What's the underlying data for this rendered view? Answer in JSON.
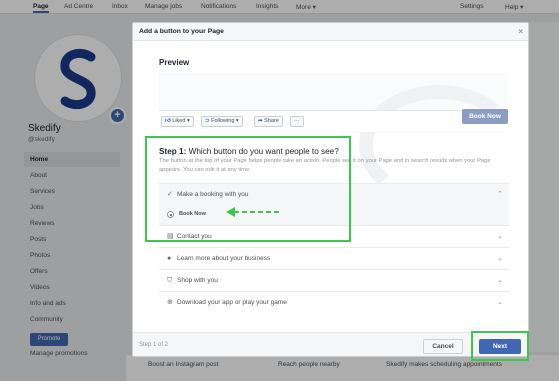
{
  "nav": {
    "tabs": [
      "Page",
      "Ad Centre",
      "Inbox",
      "Manage jobs",
      "Notifications",
      "Insights",
      "More ▾",
      "Settings",
      "Help ▾"
    ]
  },
  "page": {
    "name": "Skedify",
    "handle": "@skedify",
    "menu": [
      "Home",
      "About",
      "Services",
      "Jobs",
      "Reviews",
      "Posts",
      "Photos",
      "Offers",
      "Videos",
      "Info and ads",
      "Community"
    ],
    "promote_label": "Promote",
    "manage_promotions": "Manage promotions"
  },
  "bottom_strip": {
    "items": [
      "Boost an Instagram post",
      "Reach people nearby",
      "Skedify makes scheduling appointments"
    ]
  },
  "dialog": {
    "title": "Add a button to your Page",
    "close": "×",
    "preview_title": "Preview",
    "preview_buttons": {
      "liked": "Liked ▾",
      "following": "Following ▾",
      "share": "Share",
      "more": "···"
    },
    "book_now": "Book Now",
    "step_title_bold": "Step 1:",
    "step_title_rest": " Which button do you want people to see?",
    "step_desc": "The button at the top of your Page helps people take an action. People see it on your Page and in search results when your Page appears. You can edit it at any time.",
    "options": [
      {
        "label": "Make a booking with you",
        "icon": "check-icon",
        "chevron": "⌃"
      },
      {
        "label": "Contact you",
        "icon": "contact-icon",
        "chevron": "⌄"
      },
      {
        "label": "Learn more about your business",
        "icon": "info-icon",
        "chevron": "⌄"
      },
      {
        "label": "Shop with you",
        "icon": "shop-icon",
        "chevron": "⌄"
      },
      {
        "label": "Download your app or play your game",
        "icon": "download-icon",
        "chevron": "⌄"
      }
    ],
    "sub_option": "Book Now",
    "step_count": "Step 1 of 2",
    "cancel_label": "Cancel",
    "next_label": "Next"
  },
  "colors": {
    "brand": "#4267b2",
    "highlight": "#3ec64f",
    "logo": "#1b3a8a"
  }
}
